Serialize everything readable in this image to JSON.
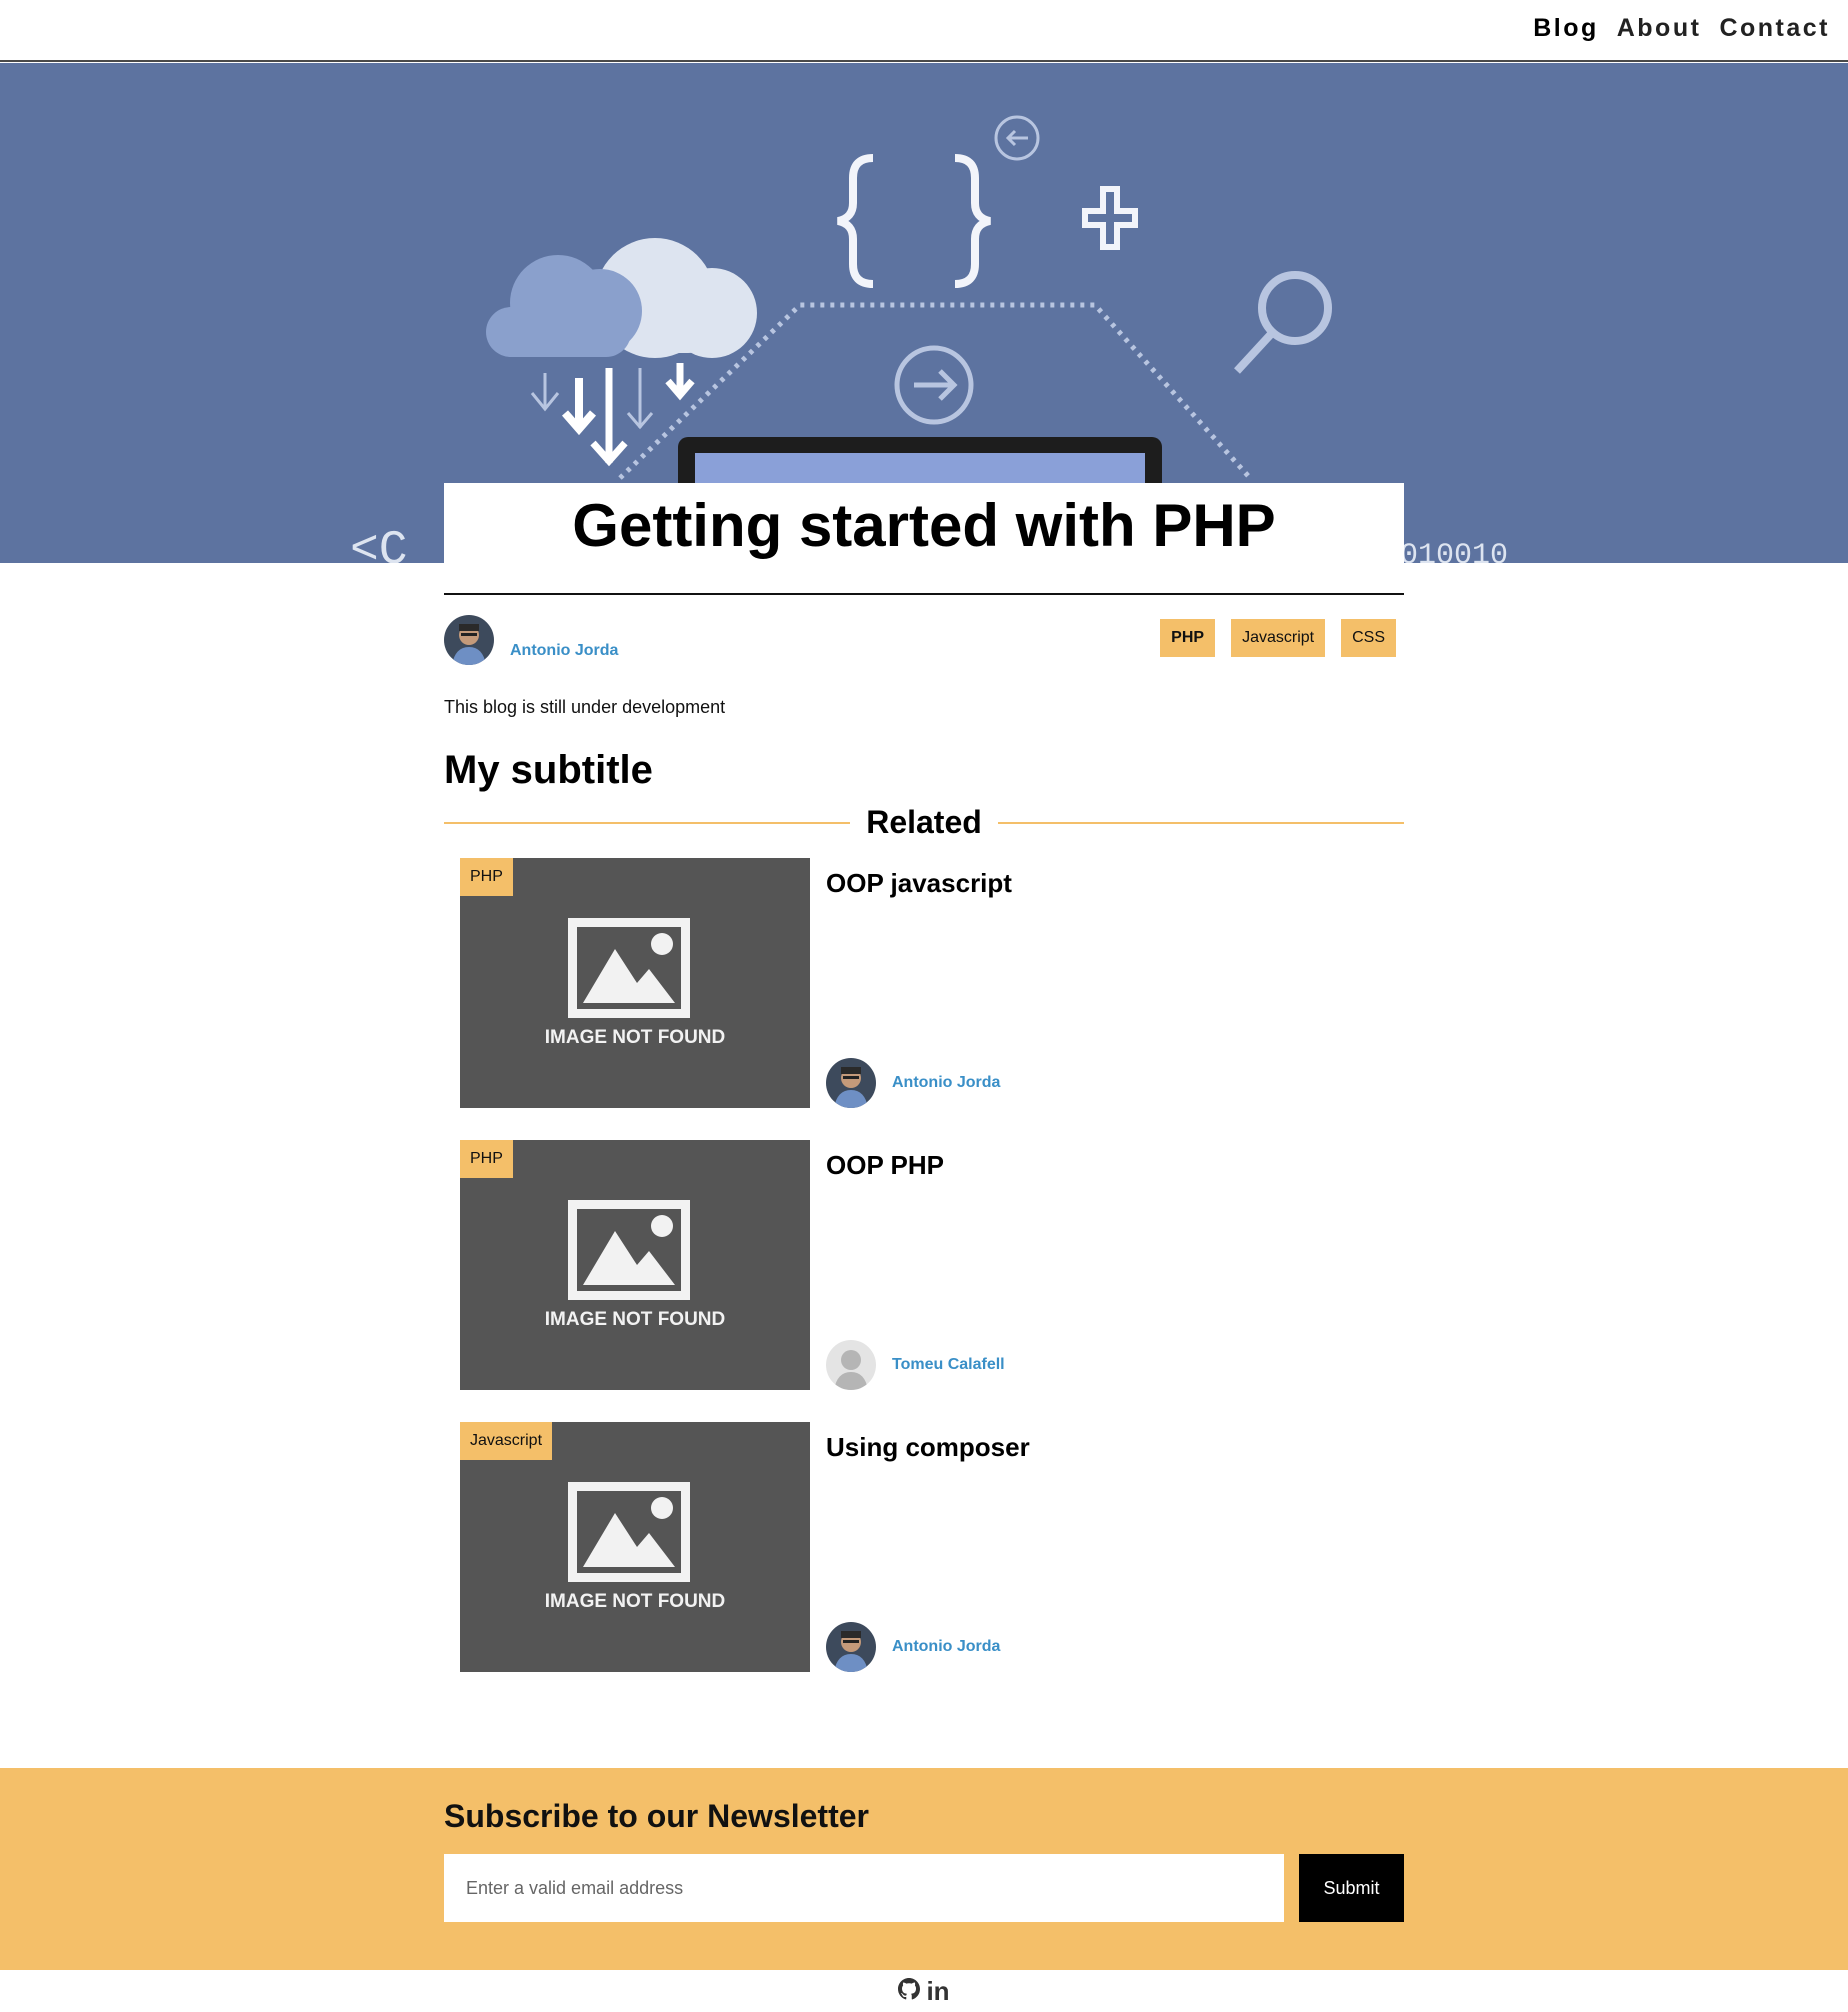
{
  "nav": {
    "items": [
      {
        "label": "Blog"
      },
      {
        "label": "About"
      },
      {
        "label": "Contact"
      }
    ]
  },
  "hero": {
    "icon_glyphs": [
      "cloud-download-icon",
      "code-braces-icon",
      "arrow-left-circle-icon",
      "plus-icon",
      "search-icon",
      "arrow-right-circle-icon",
      "laptop-icon"
    ]
  },
  "post": {
    "title": "Getting started with PHP",
    "author": "Antonio Jorda",
    "tags": [
      "PHP",
      "Javascript",
      "CSS"
    ],
    "body": "This blog is still under development",
    "subtitle": "My subtitle"
  },
  "related": {
    "heading": "Related",
    "cards": [
      {
        "tag": "PHP",
        "image_text": "IMAGE NOT FOUND",
        "title": "OOP javascript",
        "author": "Antonio Jorda"
      },
      {
        "tag": "PHP",
        "image_text": "IMAGE NOT FOUND",
        "title": "OOP PHP",
        "author": "Tomeu Calafell"
      },
      {
        "tag": "Javascript",
        "image_text": "IMAGE NOT FOUND",
        "title": "Using composer",
        "author": "Antonio Jorda"
      }
    ]
  },
  "newsletter": {
    "title": "Subscribe to our Newsletter",
    "placeholder": "Enter a valid email address",
    "submit": "Submit"
  },
  "footer": {
    "linkedin_text": "in",
    "icons": [
      "github-icon",
      "linkedin-icon"
    ]
  },
  "colors": {
    "accent": "#f4bf69",
    "hero_bg": "#5d73a0",
    "author_link": "#3a8fc7",
    "thumb_bg": "#555555"
  }
}
